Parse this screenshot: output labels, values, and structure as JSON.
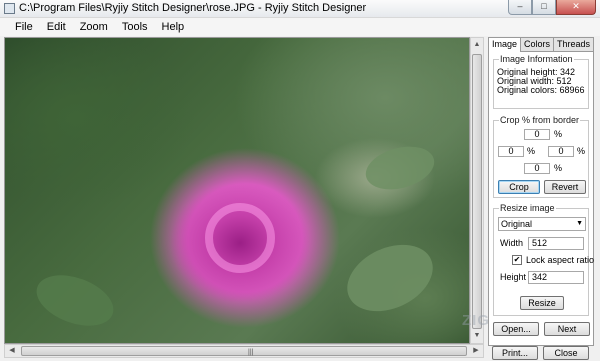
{
  "window": {
    "title": "C:\\Program Files\\Ryjiy Stitch Designer\\rose.JPG - Ryjiy Stitch Designer",
    "minimize_glyph": "‒",
    "maximize_glyph": "□",
    "close_glyph": "✕"
  },
  "menu": [
    "File",
    "Edit",
    "Zoom",
    "Tools",
    "Help"
  ],
  "image": {
    "description_icon": "rose-photo"
  },
  "scrollbars": {
    "up": "▲",
    "down": "▼",
    "left": "◀",
    "right": "▶",
    "grip": "|||"
  },
  "panel": {
    "tabs": [
      "Image",
      "Colors",
      "Threads"
    ],
    "active_tab": "Image",
    "image_info": {
      "label": "Image Information",
      "lines": [
        "Original height: 342",
        "Original width: 512",
        "Original colors: 68966"
      ]
    },
    "crop": {
      "label": "Crop % from border",
      "top": "0",
      "left": "0",
      "right": "0",
      "bottom": "0",
      "unit": "%",
      "crop_button": "Crop",
      "revert_button": "Revert"
    },
    "resize": {
      "label": "Resize image",
      "mode_selected": "Original",
      "width_label": "Width",
      "width_value": "512",
      "lock_checked": true,
      "lock_label": "Lock aspect ratio",
      "height_label": "Height",
      "height_value": "342",
      "resize_button": "Resize"
    },
    "bottom_buttons": {
      "open": "Open...",
      "next": "Next",
      "print": "Print...",
      "close": "Close"
    }
  },
  "watermark": "ZIGG"
}
